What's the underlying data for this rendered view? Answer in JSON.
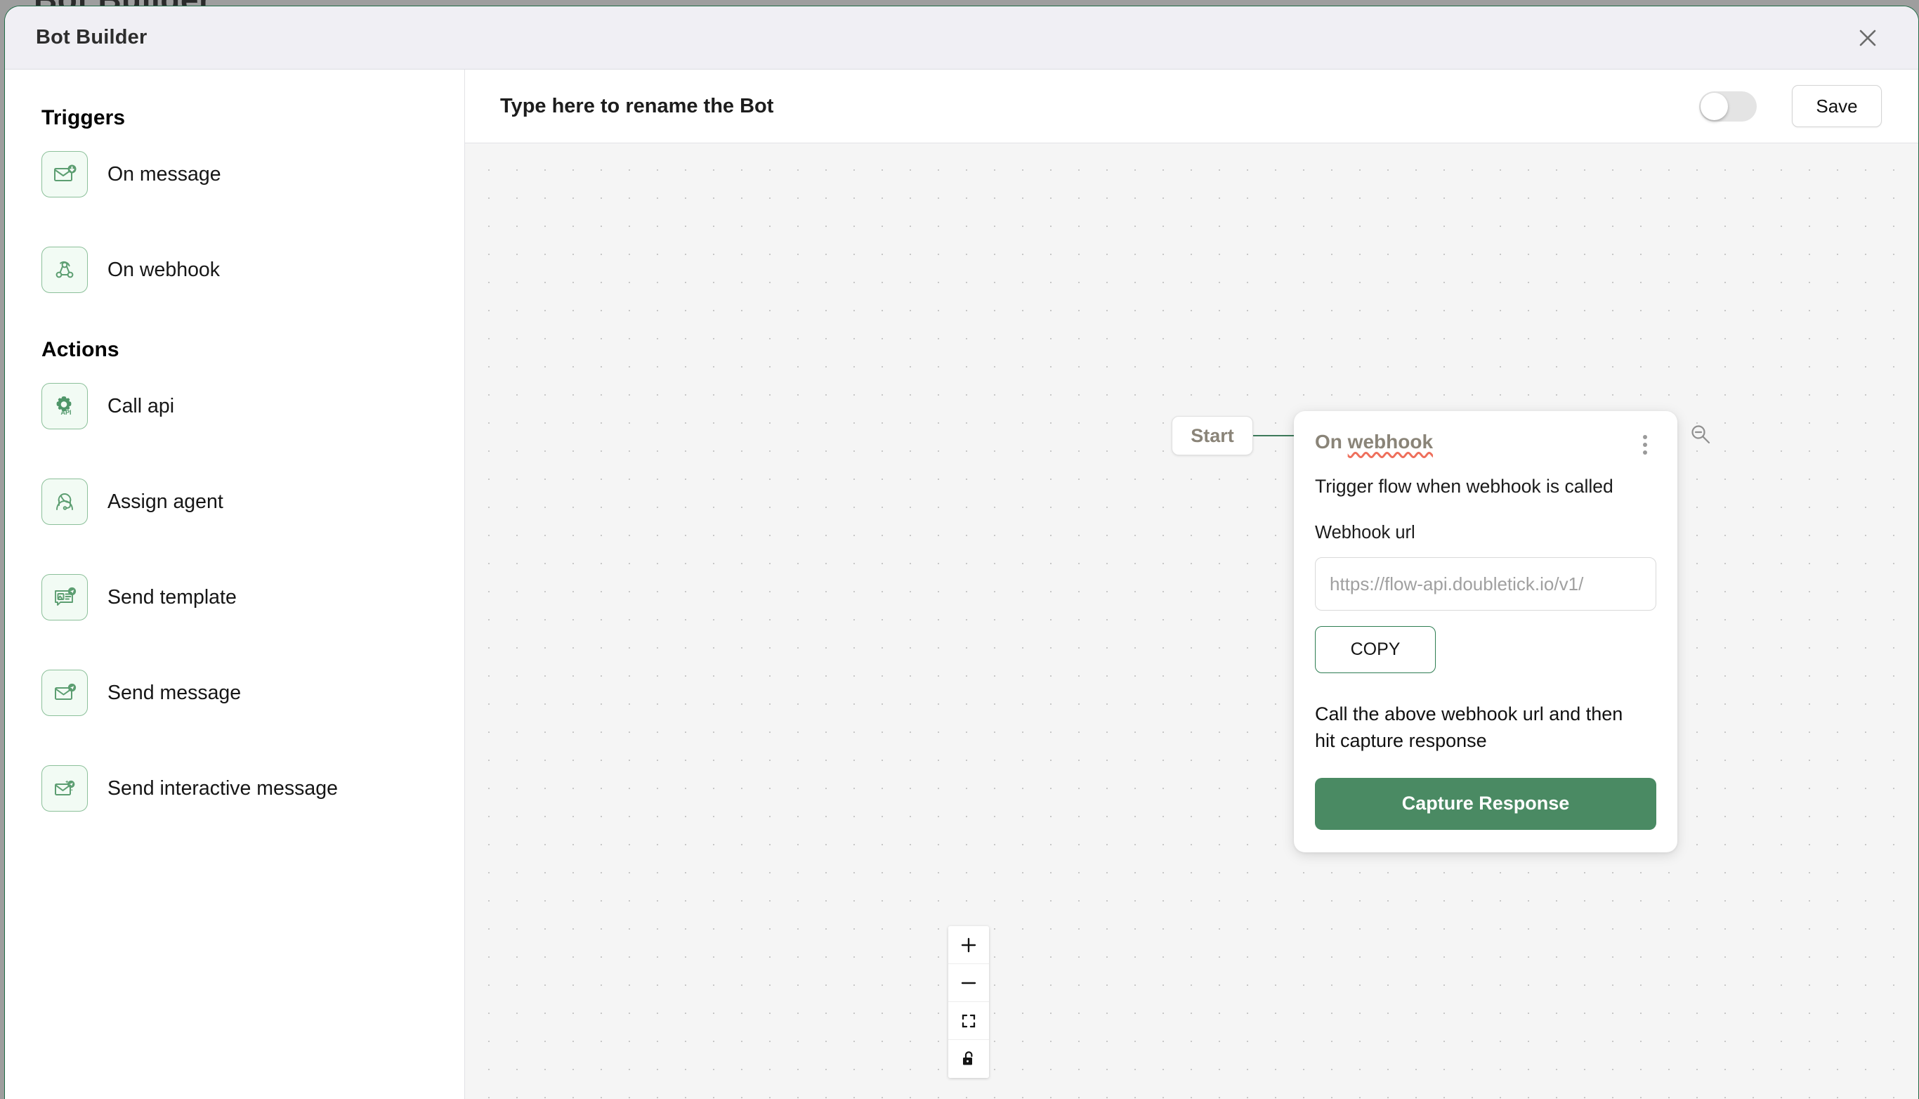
{
  "background": {
    "page_title": "Bot Builder"
  },
  "modal": {
    "title": "Bot Builder",
    "close_icon": "close-icon"
  },
  "sidebar": {
    "sections": [
      {
        "title": "Triggers",
        "items": [
          {
            "label": "On message",
            "icon": "envelope-download-icon"
          },
          {
            "label": "On webhook",
            "icon": "webhook-icon"
          }
        ]
      },
      {
        "title": "Actions",
        "items": [
          {
            "label": "Call api",
            "icon": "gear-api-icon"
          },
          {
            "label": "Assign agent",
            "icon": "headset-agent-icon"
          },
          {
            "label": "Send template",
            "icon": "template-send-icon"
          },
          {
            "label": "Send message",
            "icon": "envelope-send-icon"
          },
          {
            "label": "Send interactive message",
            "icon": "envelope-sparkle-send-icon"
          }
        ]
      }
    ]
  },
  "topbar": {
    "bot_name_value": "",
    "bot_name_placeholder": "Type here to rename the Bot",
    "publish_toggle_state": "off",
    "save_label": "Save"
  },
  "canvas": {
    "start_node_label": "Start",
    "zoom_out_icon": "zoom-out-icon",
    "controls": [
      {
        "name": "zoom-in",
        "icon": "plus-icon"
      },
      {
        "name": "zoom-out",
        "icon": "minus-icon"
      },
      {
        "name": "fit-view",
        "icon": "fit-view-icon"
      },
      {
        "name": "toggle-interactivity",
        "icon": "lock-icon"
      }
    ],
    "webhook_node": {
      "title_prefix": "On ",
      "title_misspelled": "webhook",
      "description": "Trigger flow when webhook is called",
      "url_label": "Webhook url",
      "url_value": "",
      "url_placeholder": "https://flow-api.doubletick.io/v1/",
      "copy_label": "COPY",
      "hint": "Call the above webhook url and then hit capture response",
      "capture_label": "Capture Response",
      "menu_icon": "kebab-menu-icon"
    }
  },
  "colors": {
    "accent_green": "#4a8a63",
    "border_green": "#2e7d52",
    "icon_green": "#5c9e71",
    "header_bg": "#f0eff4",
    "canvas_bg": "#f5f5f5",
    "muted_text": "#8a8478",
    "spellcheck_red": "#ee6f5c"
  }
}
